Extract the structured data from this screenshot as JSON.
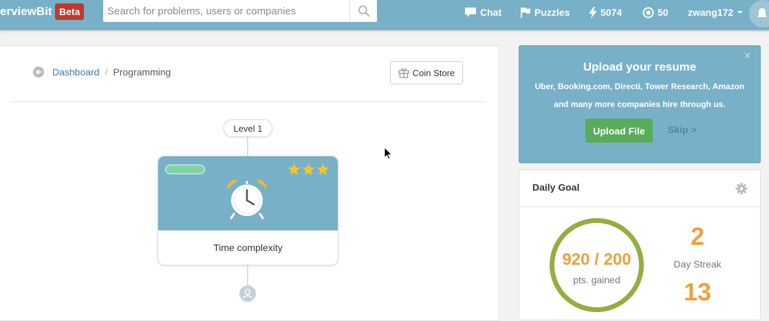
{
  "navbar": {
    "brand_text": "erviewBit",
    "beta_label": "Beta",
    "search_placeholder": "Search for problems, users or companies",
    "chat_label": "Chat",
    "puzzles_label": "Puzzles",
    "points": "5074",
    "coins": "50",
    "username": "zwang172"
  },
  "breadcrumb": {
    "dashboard": "Dashboard",
    "separator": "/",
    "current": "Programming"
  },
  "coin_store_label": "Coin Store",
  "level": {
    "label": "Level 1",
    "topic_name": "Time complexity",
    "stars": 3
  },
  "resume": {
    "close": "×",
    "title": "Upload your resume",
    "description": "Uber, Booking.com, Directi, Tower Research, Amazon and many more companies hire through us.",
    "upload_label": "Upload File",
    "skip_label": "Skip >"
  },
  "daily_goal": {
    "title": "Daily Goal",
    "progress_value": "920 / 200",
    "progress_label": "pts. gained",
    "streak_value": "2",
    "streak_label": "Day Streak",
    "second_value": "13"
  },
  "colors": {
    "navbar": "#78b0c7",
    "beta": "#c0392b",
    "accent_orange": "#f0a03c",
    "ring_green": "#94ae3f",
    "upload_green": "#5aab5a"
  }
}
